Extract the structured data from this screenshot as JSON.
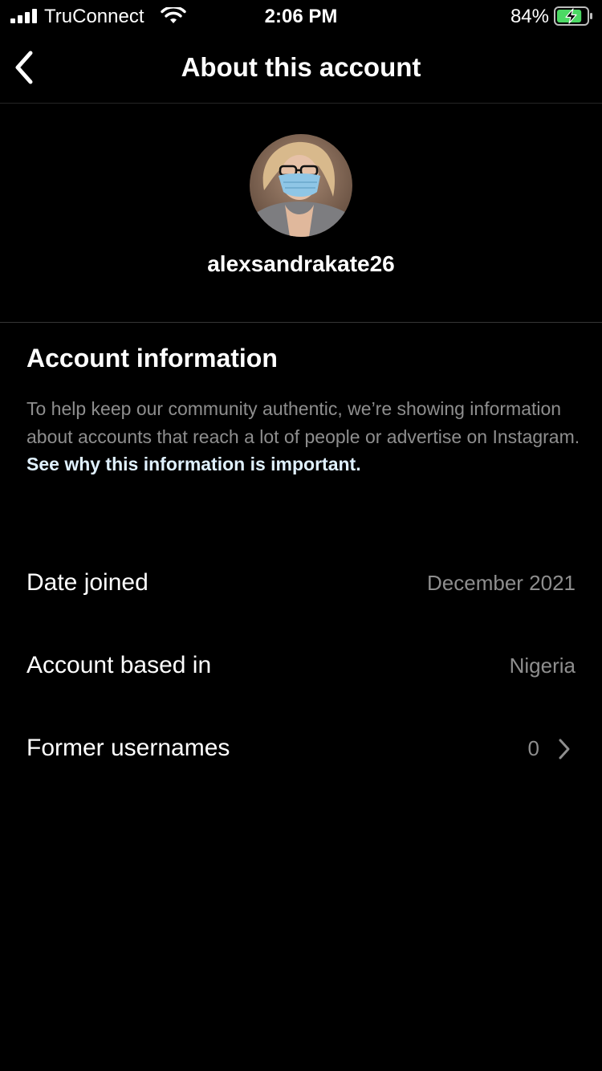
{
  "status_bar": {
    "carrier": "TruConnect",
    "time": "2:06 PM",
    "battery": "84%",
    "battery_level": 0.84,
    "signal_icon": "cellular-signal-icon",
    "wifi_icon": "wifi-icon",
    "battery_icon": "battery-charging-icon"
  },
  "nav": {
    "title": "About this account",
    "back_icon": "chevron-left-icon"
  },
  "profile": {
    "username": "alexsandrakate26"
  },
  "account_info": {
    "title": "Account information",
    "description": "To help keep our community authentic, we’re showing information about accounts that reach a lot of people or advertise on Instagram. ",
    "link": "See why this information is important."
  },
  "rows": [
    {
      "label": "Date joined",
      "value": "December 2021"
    },
    {
      "label": "Account based in",
      "value": "Nigeria"
    },
    {
      "label": "Former usernames",
      "value": "0"
    }
  ],
  "colors": {
    "background": "#000000",
    "primary_text": "#ffffff",
    "secondary_text": "#8e8e8e",
    "link": "#e0f1ff",
    "battery_green": "#4cd964"
  }
}
